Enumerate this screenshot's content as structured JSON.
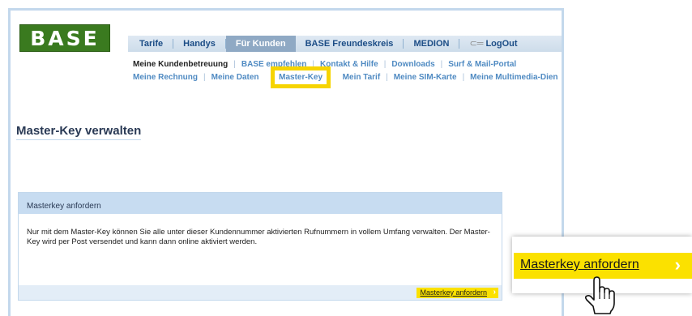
{
  "brand": {
    "logo_text": "BASE",
    "green": "#3a7a1f",
    "accent_yellow": "#fbe100",
    "highlight_yellow": "#f6d400"
  },
  "topnav": {
    "items": [
      "Tarife",
      "Handys",
      "Für Kunden",
      "BASE Freundeskreis",
      "MEDION",
      "LogOut"
    ],
    "active": "Für Kunden",
    "logout_icon": "key-icon"
  },
  "subnav": {
    "row1": [
      "Meine Kundenbetreuung",
      "BASE empfehlen",
      "Kontakt & Hilfe",
      "Downloads",
      "Surf & Mail-Portal"
    ],
    "row2": [
      "Meine Rechnung",
      "Meine Daten",
      "Master-Key",
      "Mein Tarif",
      "Meine SIM-Karte",
      "Meine Multimedia-Dien"
    ],
    "highlighted": "Master-Key"
  },
  "page": {
    "title": "Master-Key verwalten"
  },
  "panel": {
    "header": "Masterkey anfordern",
    "text": "Nur mit dem Master-Key können Sie alle unter dieser Kundennummer aktivierten Rufnummern in vollem Umfang verwalten. Der Master-Key wird per Post versendet und kann dann online aktiviert werden.",
    "button_label": "Masterkey anfordern",
    "button_chevron": "›"
  },
  "zoom": {
    "button_label": "Masterkey anfordern",
    "chevron": "›",
    "cursor_icon": "hand-pointer-icon"
  }
}
